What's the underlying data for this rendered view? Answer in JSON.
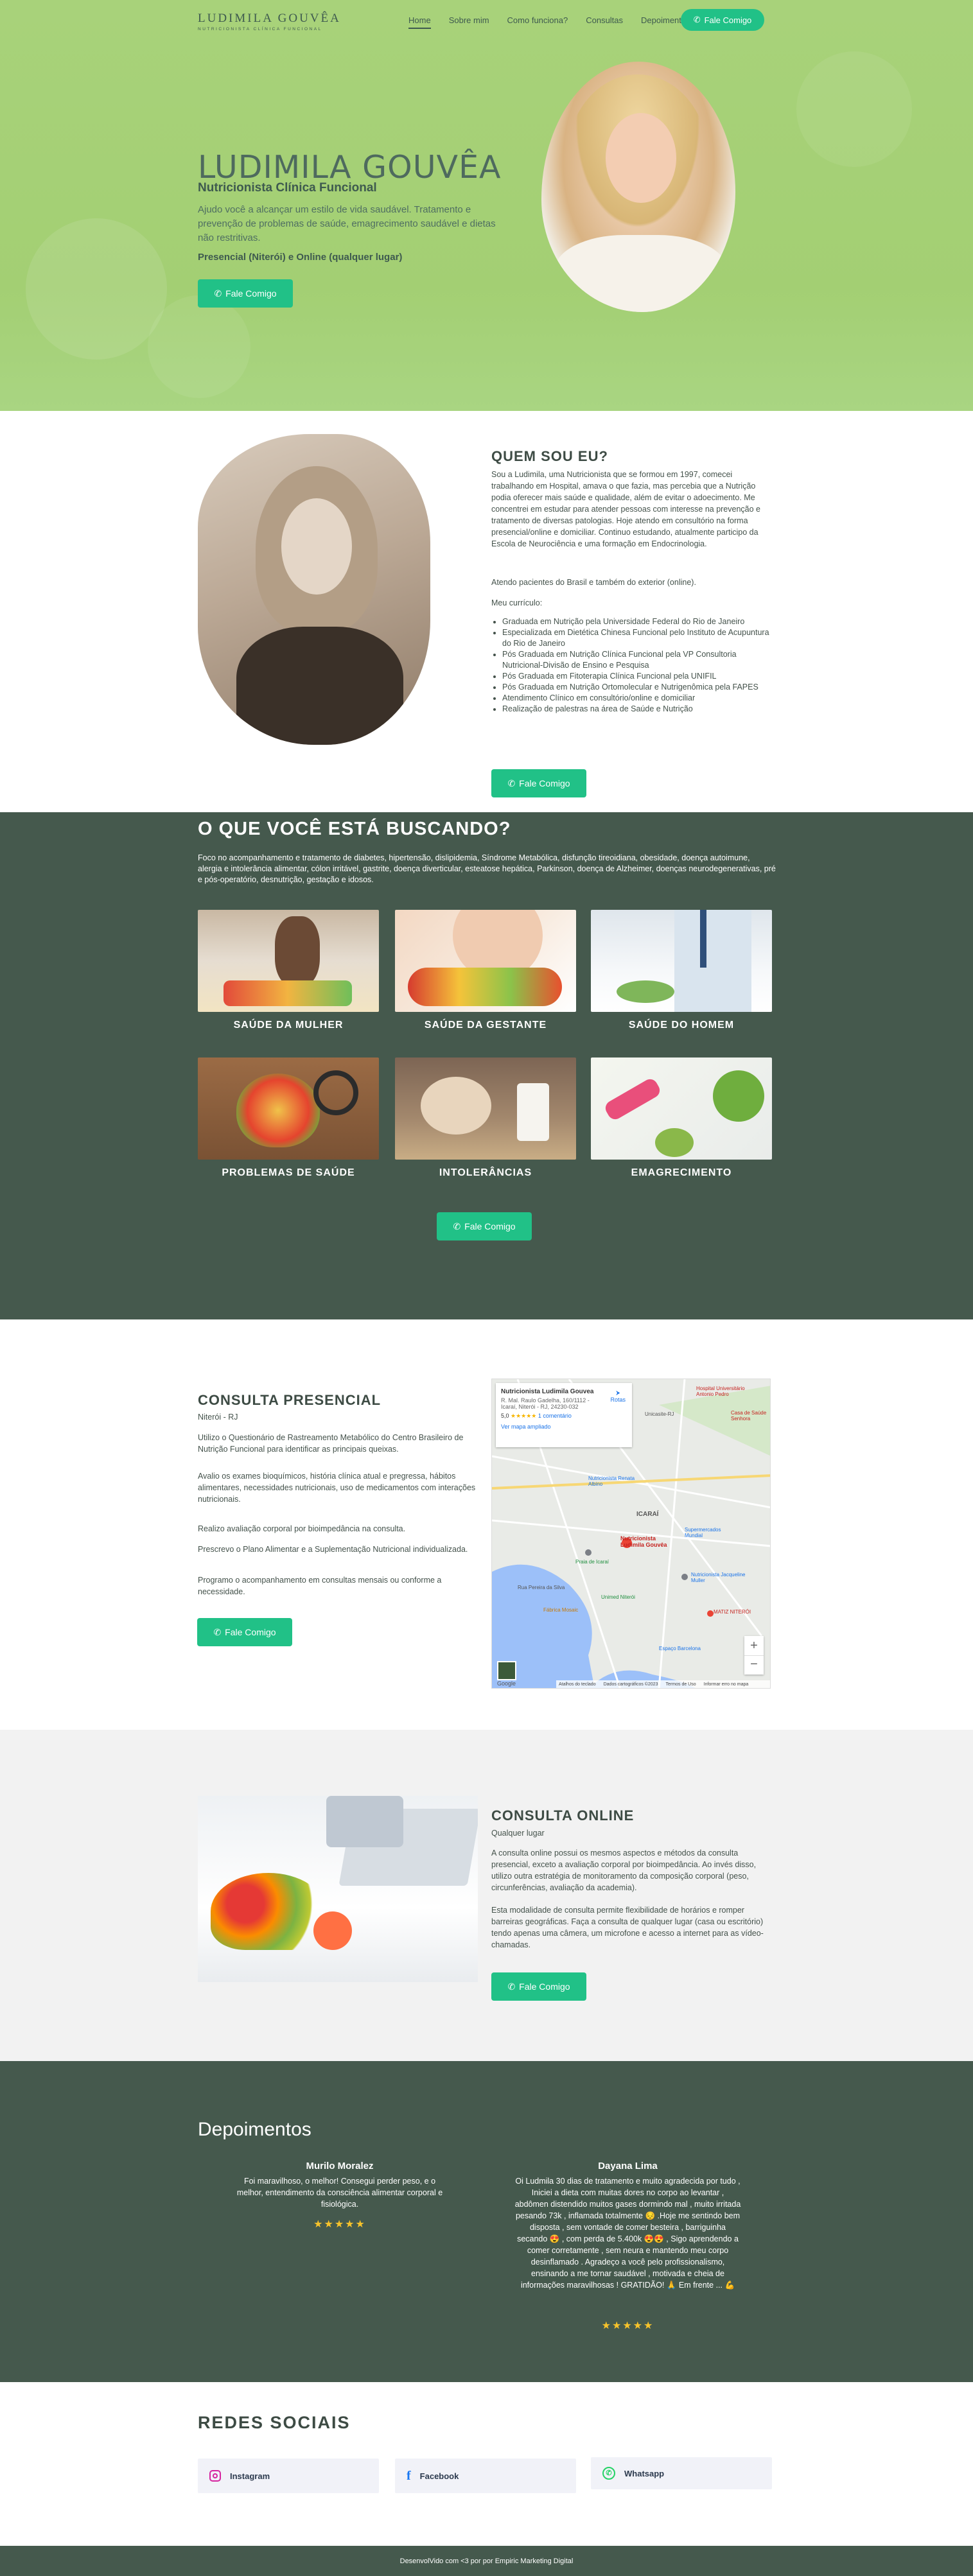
{
  "nav": {
    "logo_title": "LUDIMILA GOUVÊA",
    "logo_subtitle": "NUTRICIONISTA CLÍNICA FUNCIONAL",
    "items": [
      "Home",
      "Sobre mim",
      "Como funciona?",
      "Consultas",
      "Depoimentos"
    ],
    "active": "Home",
    "cta": "Fale Comigo"
  },
  "hero": {
    "name": "LUDIMILA GOUVÊA",
    "role": "Nutricionista Clínica Funcional",
    "description": "Ajudo você a alcançar um estilo de vida saudável. Tratamento e prevenção de problemas de saúde, emagrecimento saudável e dietas não restritivas.",
    "location": "Presencial (Niterói) e Online (qualquer lugar)",
    "cta": "Fale Comigo"
  },
  "about": {
    "title": "QUEM SOU EU?",
    "p1": "Sou a Ludimila, uma Nutricionista que se formou em 1997, comecei trabalhando em Hospital, amava o que fazia, mas percebia que a Nutrição podia oferecer mais saúde e qualidade, além de evitar o adoecimento. Me concentrei em estudar para atender pessoas com interesse na prevenção e tratamento de diversas patologias. Hoje atendo em consultório na forma presencial/online e domiciliar. Continuo estudando, atualmente participo da Escola de Neurociência e uma formação em Endocrinologia.",
    "p2": "Atendo pacientes do Brasil e também do exterior (online).",
    "p3": "Meu currículo:",
    "cv": [
      "Graduada em Nutrição pela Universidade Federal do Rio de Janeiro",
      "Especializada em Dietética Chinesa Funcional pelo Instituto de Acupuntura do Rio de Janeiro",
      "Pós Graduada em Nutrição Clínica Funcional pela VP Consultoria Nutricional-Divisão de Ensino e Pesquisa",
      "Pós Graduada em Fitoterapia Clínica Funcional pela UNIFIL",
      "Pós Graduada em Nutrição Ortomolecular e Nutrigenômica pela FAPES",
      "Atendimento Clínico em consultório/online e domiciliar",
      "Realização de palestras na área de Saúde e Nutrição"
    ],
    "cta": "Fale Comigo"
  },
  "services": {
    "title": "O QUE VOCÊ ESTÁ BUSCANDO?",
    "description": "Foco no acompanhamento e tratamento de diabetes, hipertensão, dislipidemia, Síndrome Metabólica, disfunção tireoidiana, obesidade, doença autoimune, alergia e intolerância alimentar, cólon irritável, gastrite, doença diverticular, esteatose hepática, Parkinson, doença de Alzheimer, doenças neurodegenerativas, pré e pós-operatório, desnutrição, gestação e idosos.",
    "cards": [
      "SAÚDE DA MULHER",
      "SAÚDE DA GESTANTE",
      "SAÚDE DO HOMEM",
      "PROBLEMAS DE SAÚDE",
      "INTOLERÂNCIAS",
      "EMAGRECIMENTO"
    ],
    "cta": "Fale Comigo"
  },
  "presencial": {
    "title": "CONSULTA PRESENCIAL",
    "subtitle": "Niterói - RJ",
    "p1": "Utilizo o Questionário de Rastreamento Metabólico do Centro Brasileiro de Nutrição Funcional para identificar as principais queixas.",
    "p2": "Avalio os exames bioquímicos, história clínica atual e pregressa, hábitos alimentares, necessidades nutricionais, uso de medicamentos com interações nutricionais.",
    "p3": "Realizo avaliação corporal por bioimpedância na consulta.",
    "p4": "Prescrevo o Plano Alimentar e a Suplementação Nutricional individualizada.",
    "p5": "Programo o acompanhamento em consultas mensais ou conforme a necessidade.",
    "cta": "Fale Comigo",
    "map": {
      "place_name": "Nutricionista Ludimila Gouvea",
      "address": "R. Mal. Raulo Gadelha, 160/1112 - Icaraí, Niterói - RJ, 24230-032",
      "rating": "5,0",
      "reviews": "1 comentário",
      "directions": "Rotas",
      "larger_map": "Ver mapa ampliado",
      "labels": [
        "Hospital Universitário Antonio Pedro",
        "Unicasite-RJ",
        "Casa de Saúde Senhora",
        "Nutricionista Renata Albino",
        "Nutricionista Ludimila Gouvêa",
        "ICARAÍ",
        "Praia de Icaraí",
        "Nutricionista Jacqueline Muller",
        "Unimed Niterói",
        "MATIZ NITERÓI",
        "Espaço Barcelona",
        "Rua Pereira da Silva",
        "Supermercados Mundial",
        "Fábrica Mosaic"
      ],
      "footer_shortcuts": "Atalhos do teclado",
      "footer_data": "Dados cartográficos ©2023",
      "footer_terms": "Termos de Uso",
      "footer_report": "Informar erro no mapa",
      "google": "Google"
    }
  },
  "online": {
    "title": "CONSULTA ONLINE",
    "subtitle": "Qualquer lugar",
    "p1": "A consulta online possui os mesmos aspectos e métodos da consulta presencial, exceto a avaliação corporal por bioimpedância. Ao invés disso, utilizo outra estratégia de monitoramento da composição corporal (peso, circunferências, avaliação da academia).",
    "p2": "Esta modalidade de consulta permite flexibilidade de horários e romper barreiras geográficas. Faça a consulta de qualquer lugar (casa ou escritório) tendo apenas uma câmera, um microfone e acesso a internet para as vídeo-chamadas.",
    "cta": "Fale Comigo"
  },
  "testimonials": {
    "title": "Depoimentos",
    "items": [
      {
        "name": "Murilo Moralez",
        "text": "Foi maravilhoso, o melhor! Consegui perder peso, e o melhor, entendimento da consciência alimentar corporal e fisiológica.",
        "stars": "★★★★★"
      },
      {
        "name": "Dayana Lima",
        "text": "Oi Ludmila 30 dias de tratamento e muito agradecida por tudo , Iniciei a dieta com muitas dores no corpo ao levantar , abdômen distendido muitos gases dormindo mal , muito irritada pesando 73k , inflamada totalmente 😔 .Hoje me sentindo bem disposta , sem vontade de comer besteira , barriguinha secando 😍 , com perda de 5.400k 😍😍 , Sigo aprendendo a comer corretamente , sem neura e mantendo meu corpo desinflamado . Agradeço a você pelo profissionalismo, ensinando a me tornar saudável , motivada e cheia de informações maravilhosas ! GRATIDÃO! 🙏 Em frente ... 💪",
        "stars": "★★★★★"
      }
    ]
  },
  "social": {
    "title": "REDES SOCIAIS",
    "items": [
      "Instagram",
      "Facebook",
      "Whatsapp"
    ]
  },
  "footer": {
    "text": "DesenvolVido com <3 por por Empiric Marketing Digital"
  },
  "colors": {
    "hero_green": "#a5d076",
    "dark_green": "#45594d",
    "cta_green": "#21c187"
  }
}
